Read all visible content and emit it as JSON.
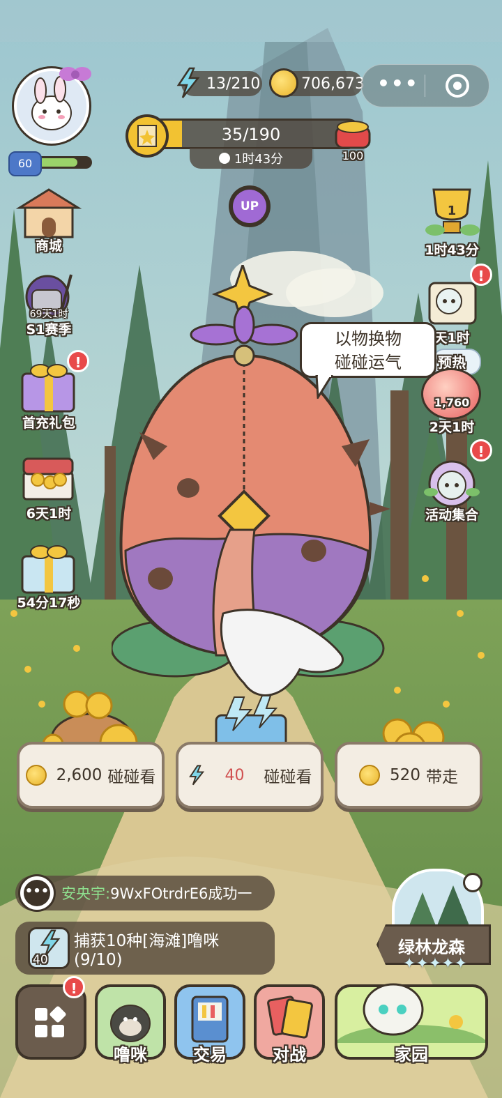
{
  "header": {
    "energy": "13/210",
    "coins": "706,673",
    "more_icon": "ellipsis-icon",
    "target_icon": "record-icon"
  },
  "player": {
    "level": "60"
  },
  "progress": {
    "value": "35/190",
    "fill": 0.184,
    "timer": "1时43分",
    "reward_count": "100"
  },
  "up_label": "UP",
  "left_menu": [
    {
      "label": "商城"
    },
    {
      "label": "S1赛季",
      "sub": "69天1时"
    },
    {
      "label": "首充礼包"
    },
    {
      "label": "6天1时"
    },
    {
      "label": "54分17秒"
    }
  ],
  "right_menu": [
    {
      "label": "1时43分",
      "rank": "1"
    },
    {
      "label": "天1时"
    },
    {
      "label": "预热"
    },
    {
      "label": "2天1时",
      "value": "1,760"
    },
    {
      "label": "活动集合"
    }
  ],
  "speech": {
    "line1": "以物换物",
    "line2": "碰碰运气"
  },
  "actions": [
    {
      "amount": "2,600",
      "label": "碰碰看"
    },
    {
      "amount": "40",
      "label": "碰碰看"
    },
    {
      "amount": "520",
      "label": "带走"
    }
  ],
  "feed": {
    "user": "安央宇:",
    "message": "9WxFOtrdrE6成功一"
  },
  "quest": {
    "title": "捕获10种[海滩]噜咪",
    "progress": "(9/10)",
    "reward": "40"
  },
  "location": {
    "name": "绿林龙森",
    "stars": "✦✦✦✦✦"
  },
  "nav": [
    {
      "label": ""
    },
    {
      "label": "噜咪"
    },
    {
      "label": "交易"
    },
    {
      "label": "对战"
    },
    {
      "label": "家园"
    }
  ],
  "colors": {
    "accent": "#f2c232",
    "energy": "#7fd6e8",
    "badge": "#e84a4a",
    "path": "#d9c792"
  }
}
